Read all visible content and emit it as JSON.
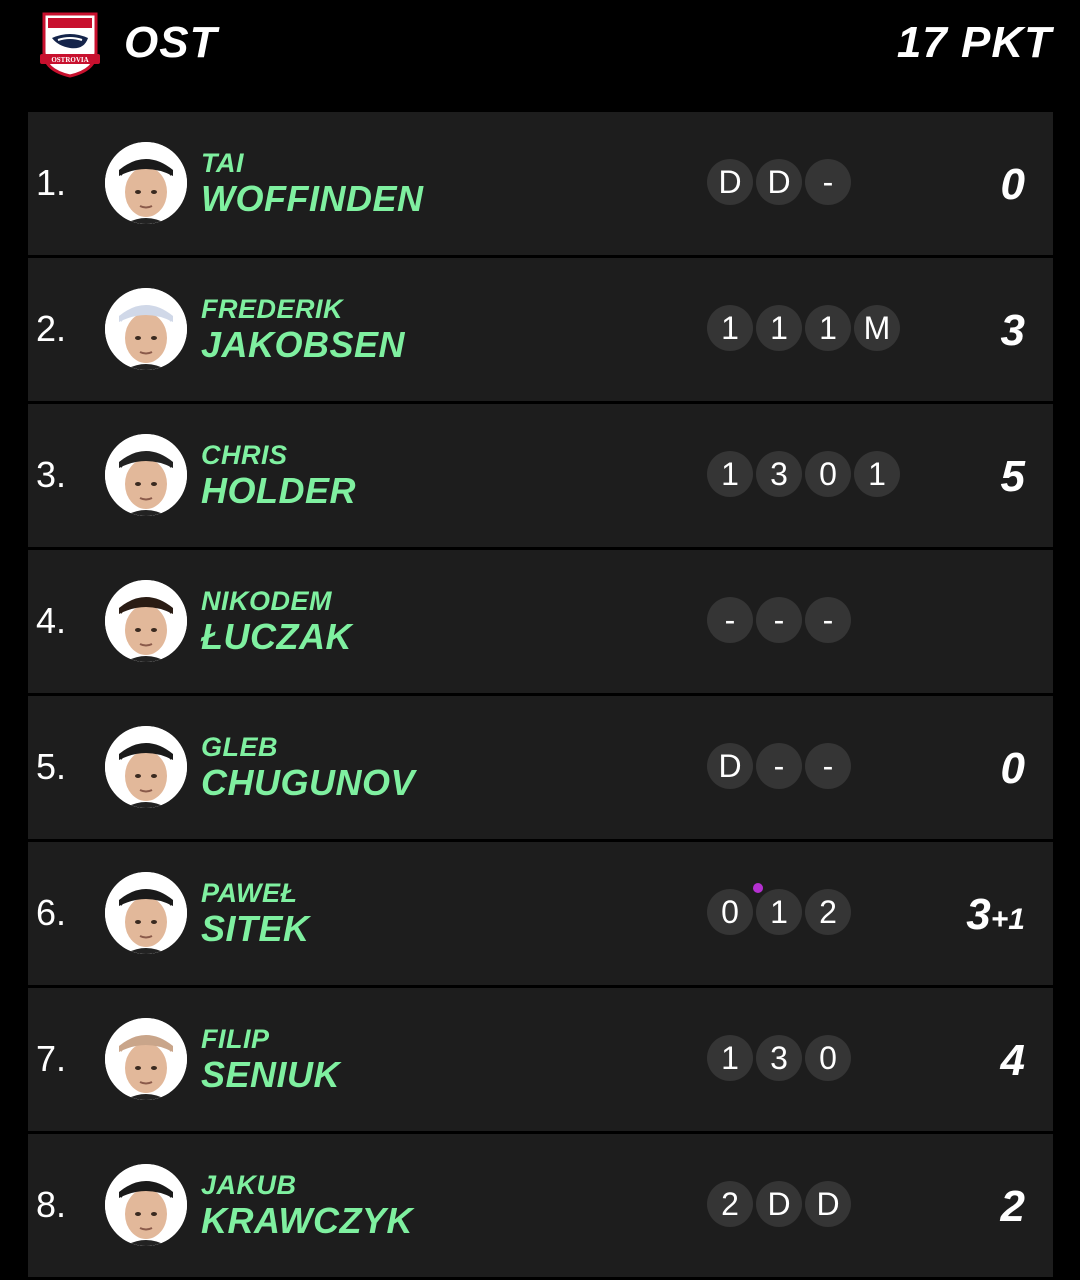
{
  "header": {
    "logo_text": "OSTROVIA",
    "team_code": "OST",
    "team_points": "17 PKT"
  },
  "riders": [
    {
      "pos": "1.",
      "first": "TAI",
      "last": "WOFFINDEN",
      "heats": [
        "D",
        "D",
        "-"
      ],
      "total": "0",
      "bonus": "",
      "helmet": "#1a1a1a"
    },
    {
      "pos": "2.",
      "first": "FREDERIK",
      "last": "JAKOBSEN",
      "heats": [
        "1",
        "1",
        "1",
        "M"
      ],
      "total": "3",
      "bonus": "",
      "helmet": "#d0d8e8"
    },
    {
      "pos": "3.",
      "first": "CHRIS",
      "last": "HOLDER",
      "heats": [
        "1",
        "3",
        "0",
        "1"
      ],
      "total": "5",
      "bonus": "",
      "helmet": "#222"
    },
    {
      "pos": "4.",
      "first": "NIKODEM",
      "last": "ŁUCZAK",
      "heats": [
        "-",
        "-",
        "-"
      ],
      "total": "",
      "bonus": "",
      "helmet": "#2a1c14"
    },
    {
      "pos": "5.",
      "first": "GLEB",
      "last": "CHUGUNOV",
      "heats": [
        "D",
        "-",
        "-"
      ],
      "total": "0",
      "bonus": "",
      "helmet": "#1a1a1a"
    },
    {
      "pos": "6.",
      "first": "PAWEŁ",
      "last": "SITEK",
      "heats": [
        "0",
        "1",
        "2"
      ],
      "total": "3",
      "bonus": "+1",
      "helmet": "#1a1a1a"
    },
    {
      "pos": "7.",
      "first": "FILIP",
      "last": "SENIUK",
      "heats": [
        "1",
        "3",
        "0"
      ],
      "total": "4",
      "bonus": "",
      "helmet": "#c9a58a"
    },
    {
      "pos": "8.",
      "first": "JAKUB",
      "last": "KRAWCZYK",
      "heats": [
        "2",
        "D",
        "D"
      ],
      "total": "2",
      "bonus": "",
      "helmet": "#1a1a1a"
    }
  ],
  "colors": {
    "background": "#000000",
    "row": "#1d1d1d",
    "name_accent": "#7ff0a0",
    "heat_pill": "#353535",
    "bonus_dot": "#b430d0"
  }
}
